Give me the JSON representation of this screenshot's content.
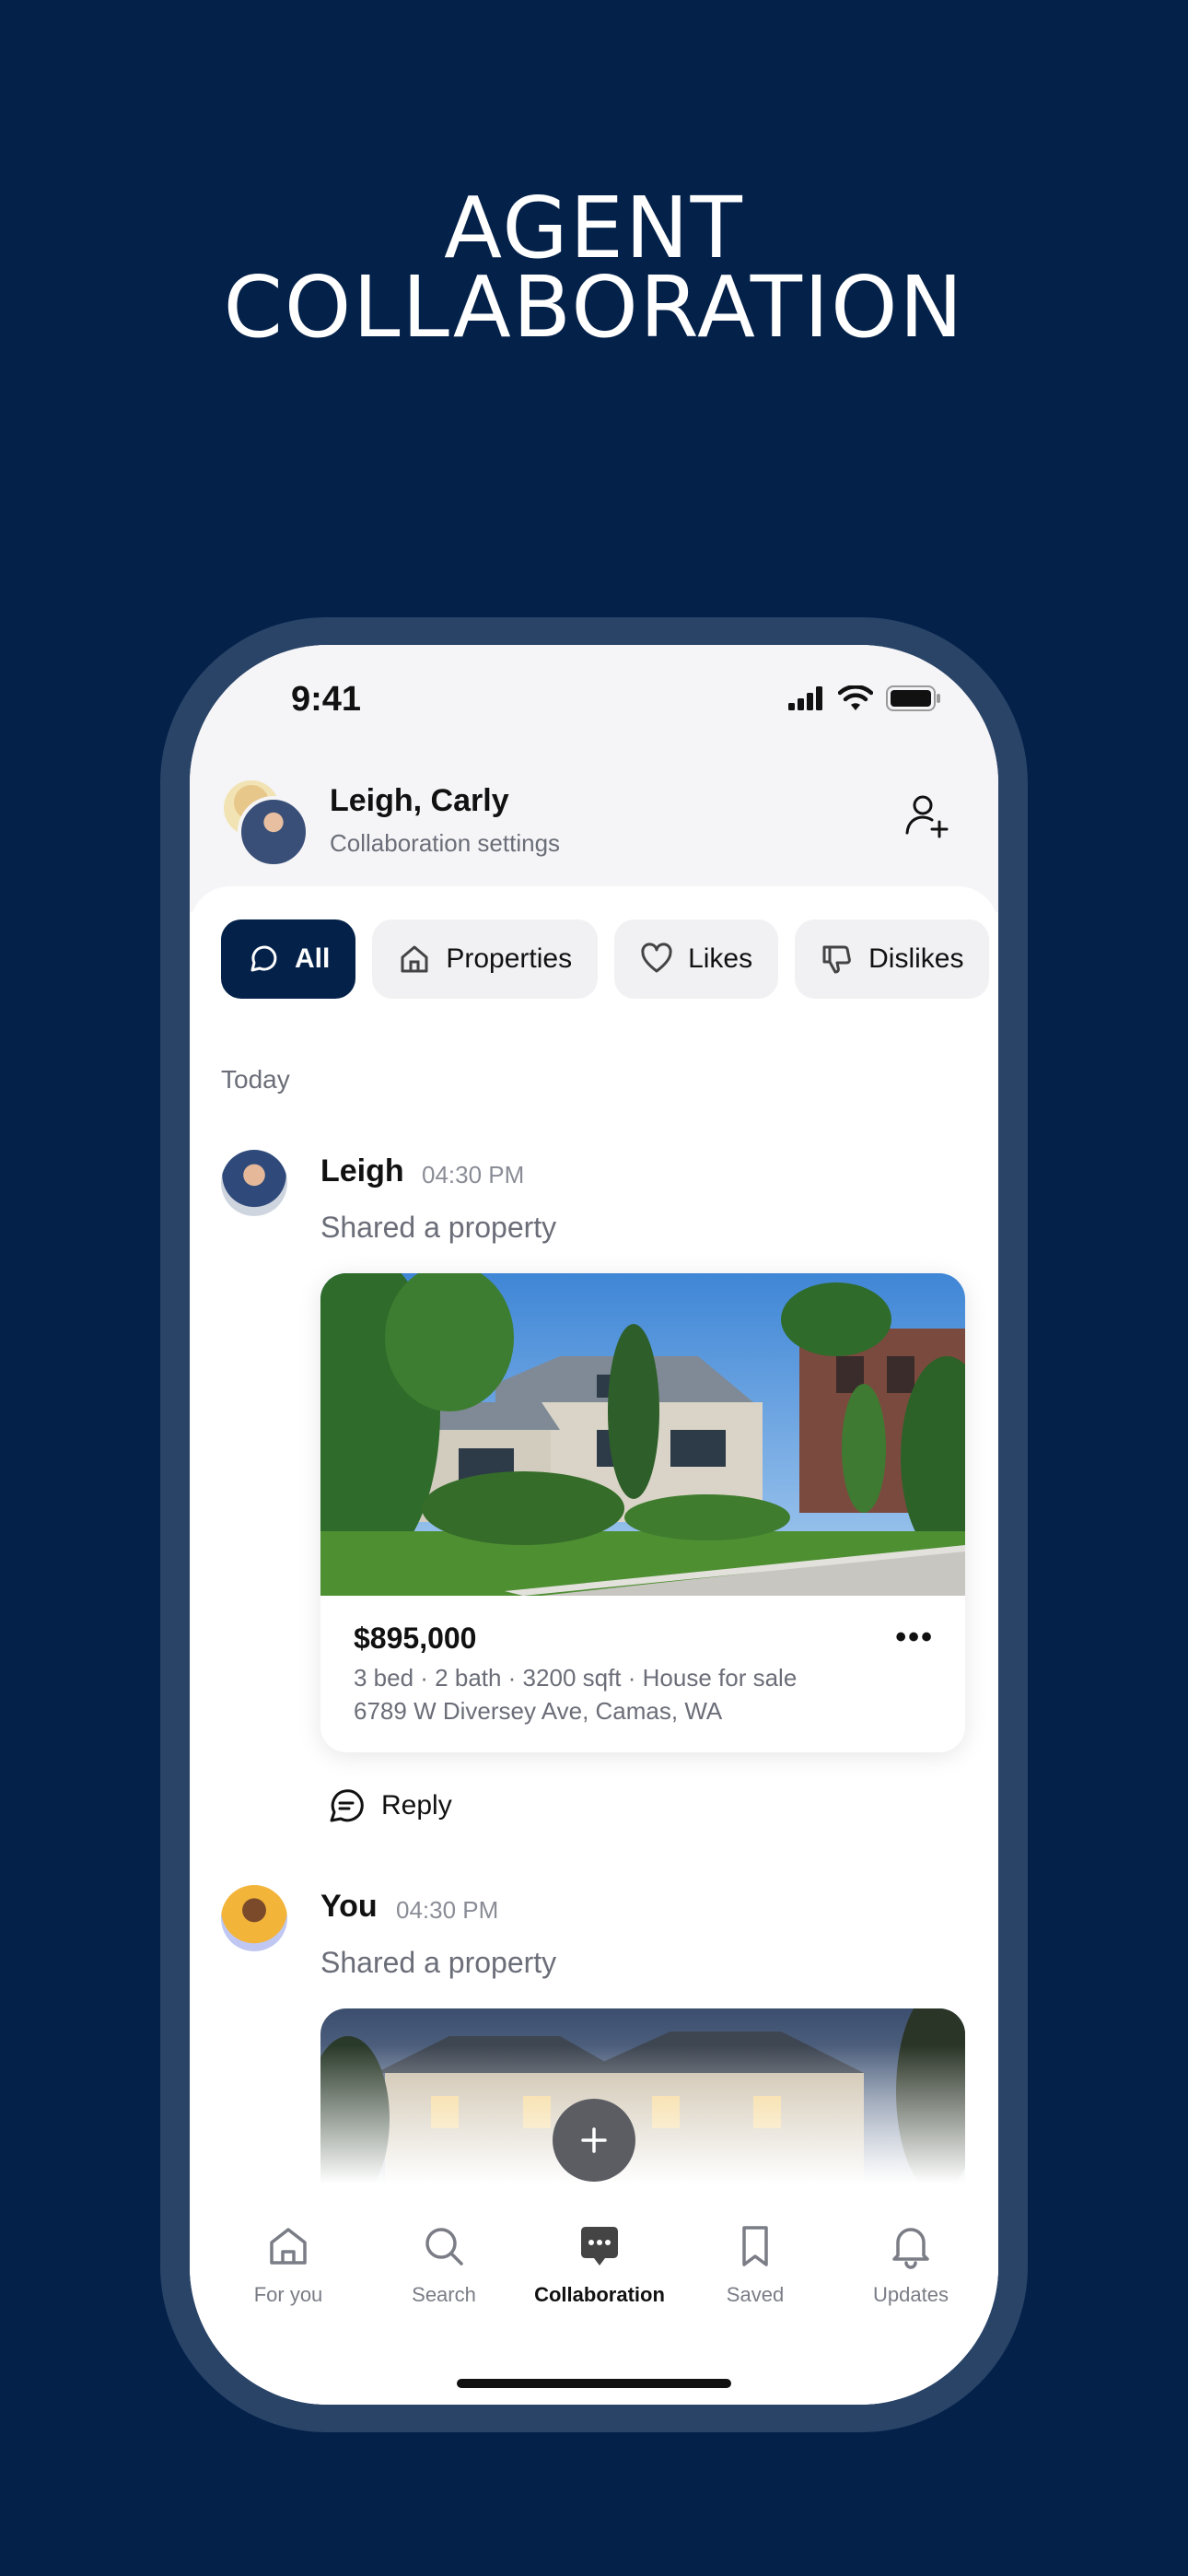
{
  "headline": {
    "line1": "AGENT",
    "line2": "COLLABORATION"
  },
  "status_bar": {
    "time": "9:41"
  },
  "header": {
    "title": "Leigh, Carly",
    "subtitle": "Collaboration settings"
  },
  "filters": [
    {
      "label": "All",
      "icon": "chat-bubble-icon",
      "active": true
    },
    {
      "label": "Properties",
      "icon": "house-icon",
      "active": false
    },
    {
      "label": "Likes",
      "icon": "heart-icon",
      "active": false
    },
    {
      "label": "Dislikes",
      "icon": "thumbs-down-icon",
      "active": false
    }
  ],
  "feed": {
    "section": "Today",
    "messages": [
      {
        "sender": "Leigh",
        "time": "04:30 PM",
        "text": "Shared a property",
        "property": {
          "price": "$895,000",
          "details": "3 bed · 2 bath · 3200 sqft · House for sale",
          "address": "6789 W Diversey Ave, Camas, WA"
        },
        "reply_label": "Reply"
      },
      {
        "sender": "You",
        "time": "04:30 PM",
        "text": "Shared a property"
      }
    ]
  },
  "tabbar": [
    {
      "label": "For you",
      "icon": "home-icon",
      "active": false
    },
    {
      "label": "Search",
      "icon": "search-icon",
      "active": false
    },
    {
      "label": "Collaboration",
      "icon": "chat-dots-icon",
      "active": true
    },
    {
      "label": "Saved",
      "icon": "bookmark-icon",
      "active": false
    },
    {
      "label": "Updates",
      "icon": "bell-icon",
      "active": false
    }
  ],
  "colors": {
    "brand_navy": "#04214a",
    "frame": "#2a4468"
  }
}
